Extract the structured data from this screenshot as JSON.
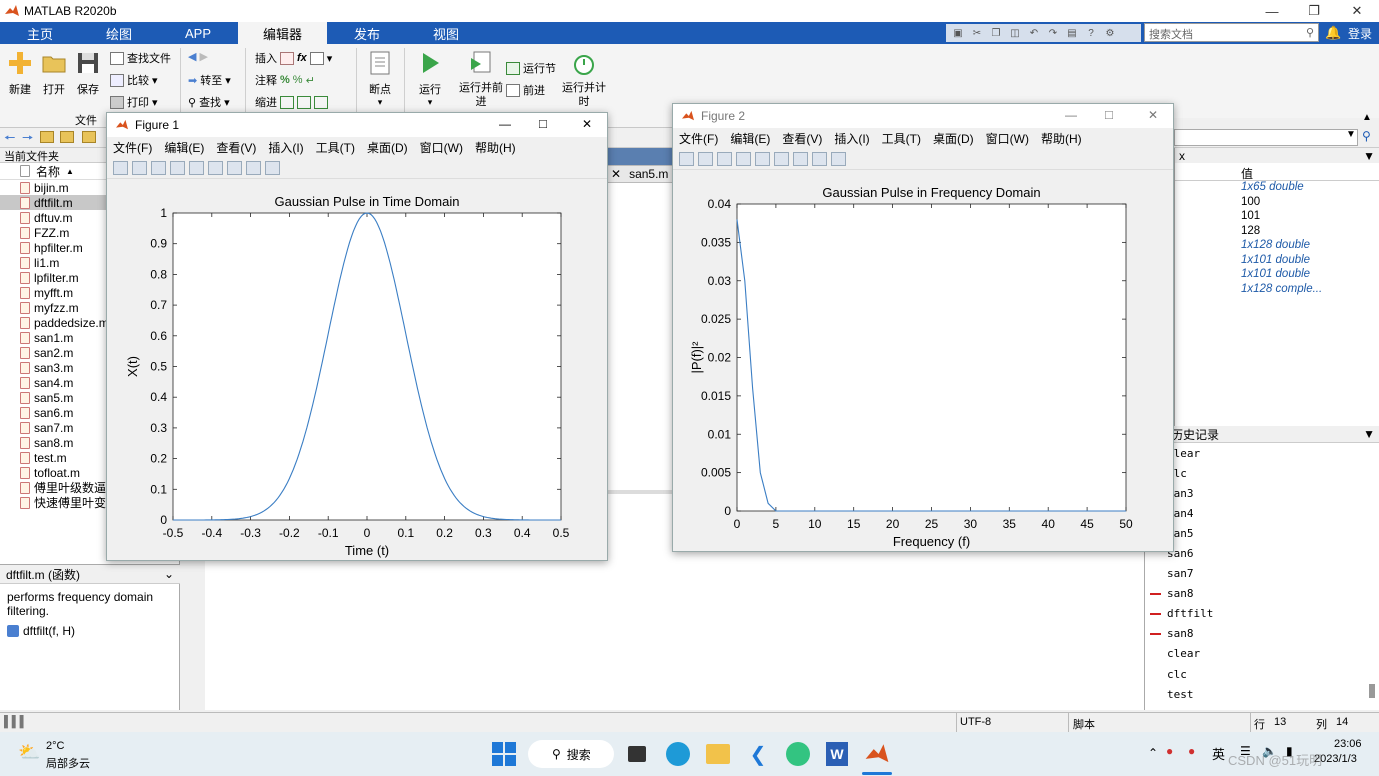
{
  "app": {
    "title": "MATLAB R2020b"
  },
  "tabs": [
    "主页",
    "绘图",
    "APP",
    "编辑器",
    "发布",
    "视图"
  ],
  "active_tab": "编辑器",
  "search": {
    "placeholder": "搜索文档"
  },
  "login": "登录",
  "ribbon": {
    "new": "新建",
    "open": "打开",
    "save": "保存",
    "find_files": "查找文件",
    "compare": "比较",
    "print": "打印",
    "goto": "转至",
    "find": "查找",
    "insert": "插入",
    "comment": "注释",
    "indent": "缩进",
    "breakpoints": "断点",
    "run": "运行",
    "run_advance": "运行并前进",
    "run_section": "运行节",
    "advance": "前进",
    "run_time": "运行并计时",
    "section_file": "文件"
  },
  "current_folder": {
    "label": "当前文件夹",
    "col_name": "名称",
    "files": [
      "bijin.m",
      "dftfilt.m",
      "dftuv.m",
      "FZZ.m",
      "hpfilter.m",
      "li1.m",
      "lpfilter.m",
      "myfft.m",
      "myfzz.m",
      "paddedsize.m",
      "san1.m",
      "san2.m",
      "san3.m",
      "san4.m",
      "san5.m",
      "san6.m",
      "san7.m",
      "san8.m",
      "test.m",
      "tofloat.m",
      "傅里叶级数逼近",
      "快速傅里叶变换"
    ],
    "selected_index": 1
  },
  "details": {
    "title": "dftfilt.m  (函数)",
    "desc": "performs frequency domain filtering.",
    "sig": "dftfilt(f, H)"
  },
  "editor_tab": "san5.m",
  "workspace": {
    "col_value": "值",
    "header_left": "x",
    "values": [
      "1x65 double",
      "100",
      "101",
      "128",
      "1x128 double",
      "1x101 double",
      "1x101 double",
      "1x128 comple..."
    ],
    "italic": [
      true,
      false,
      false,
      false,
      true,
      true,
      true,
      true
    ]
  },
  "history": {
    "title": "历史记录",
    "items": [
      "clear",
      "clc",
      "san3",
      "san4",
      "san5",
      "san6",
      "san7",
      "san8",
      "dftfilt",
      "san8",
      "clear",
      "clc",
      "test"
    ],
    "marked": [
      false,
      false,
      false,
      false,
      false,
      false,
      false,
      true,
      true,
      true,
      false,
      false,
      false
    ]
  },
  "status": {
    "encoding": "UTF-8",
    "type": "脚本",
    "row_label": "行",
    "row": "13",
    "col_label": "列",
    "col": "14"
  },
  "figure_menu": [
    "文件(F)",
    "编辑(E)",
    "查看(V)",
    "插入(I)",
    "工具(T)",
    "桌面(D)",
    "窗口(W)",
    "帮助(H)"
  ],
  "figure1": {
    "title": "Figure 1"
  },
  "figure2": {
    "title": "Figure 2"
  },
  "chart_data": [
    {
      "type": "line",
      "title": "Gaussian Pulse in Time Domain",
      "xlabel": "Time (t)",
      "ylabel": "X(t)",
      "xlim": [
        -0.5,
        0.5
      ],
      "ylim": [
        0,
        1
      ],
      "xticks": [
        "-0.5",
        "-0.4",
        "-0.3",
        "-0.2",
        "-0.1",
        "0",
        "0.1",
        "0.2",
        "0.3",
        "0.4",
        "0.5"
      ],
      "yticks": [
        "0",
        "0.1",
        "0.2",
        "0.3",
        "0.4",
        "0.5",
        "0.6",
        "0.7",
        "0.8",
        "0.9",
        "1"
      ],
      "x": [
        -0.5,
        -0.45,
        -0.4,
        -0.35,
        -0.3,
        -0.25,
        -0.2,
        -0.15,
        -0.1,
        -0.05,
        0,
        0.05,
        0.1,
        0.15,
        0.2,
        0.25,
        0.3,
        0.35,
        0.4,
        0.45,
        0.5
      ],
      "y": [
        0.0,
        0.0,
        0.0,
        0.005,
        0.02,
        0.06,
        0.16,
        0.33,
        0.55,
        0.85,
        1.0,
        0.85,
        0.55,
        0.33,
        0.16,
        0.06,
        0.02,
        0.005,
        0.0,
        0.0,
        0.0
      ],
      "color": "#3b7ec4",
      "grid": false
    },
    {
      "type": "line",
      "title": "Gaussian Pulse in Frequency Domain",
      "xlabel": "Frequency (f)",
      "ylabel": "|P(f)|²",
      "xlim": [
        0,
        50
      ],
      "ylim": [
        0,
        0.04
      ],
      "xticks": [
        "0",
        "5",
        "10",
        "15",
        "20",
        "25",
        "30",
        "35",
        "40",
        "45",
        "50"
      ],
      "yticks": [
        "0",
        "0.005",
        "0.01",
        "0.015",
        "0.02",
        "0.025",
        "0.03",
        "0.035",
        "0.04"
      ],
      "x": [
        0,
        1,
        2,
        3,
        4,
        5,
        6,
        10,
        20,
        30,
        40,
        50
      ],
      "y": [
        0.038,
        0.03,
        0.016,
        0.005,
        0.001,
        0.0,
        0.0,
        0.0,
        0.0,
        0.0,
        0.0,
        0.0
      ],
      "color": "#3b7ec4",
      "grid": false
    }
  ],
  "weather": {
    "temp": "2°C",
    "desc": "局部多云"
  },
  "taskbar": {
    "search": "搜索",
    "ime": "英",
    "time": "23:06",
    "date": "2023/1/3"
  },
  "watermark": "CSDN @51玩明"
}
